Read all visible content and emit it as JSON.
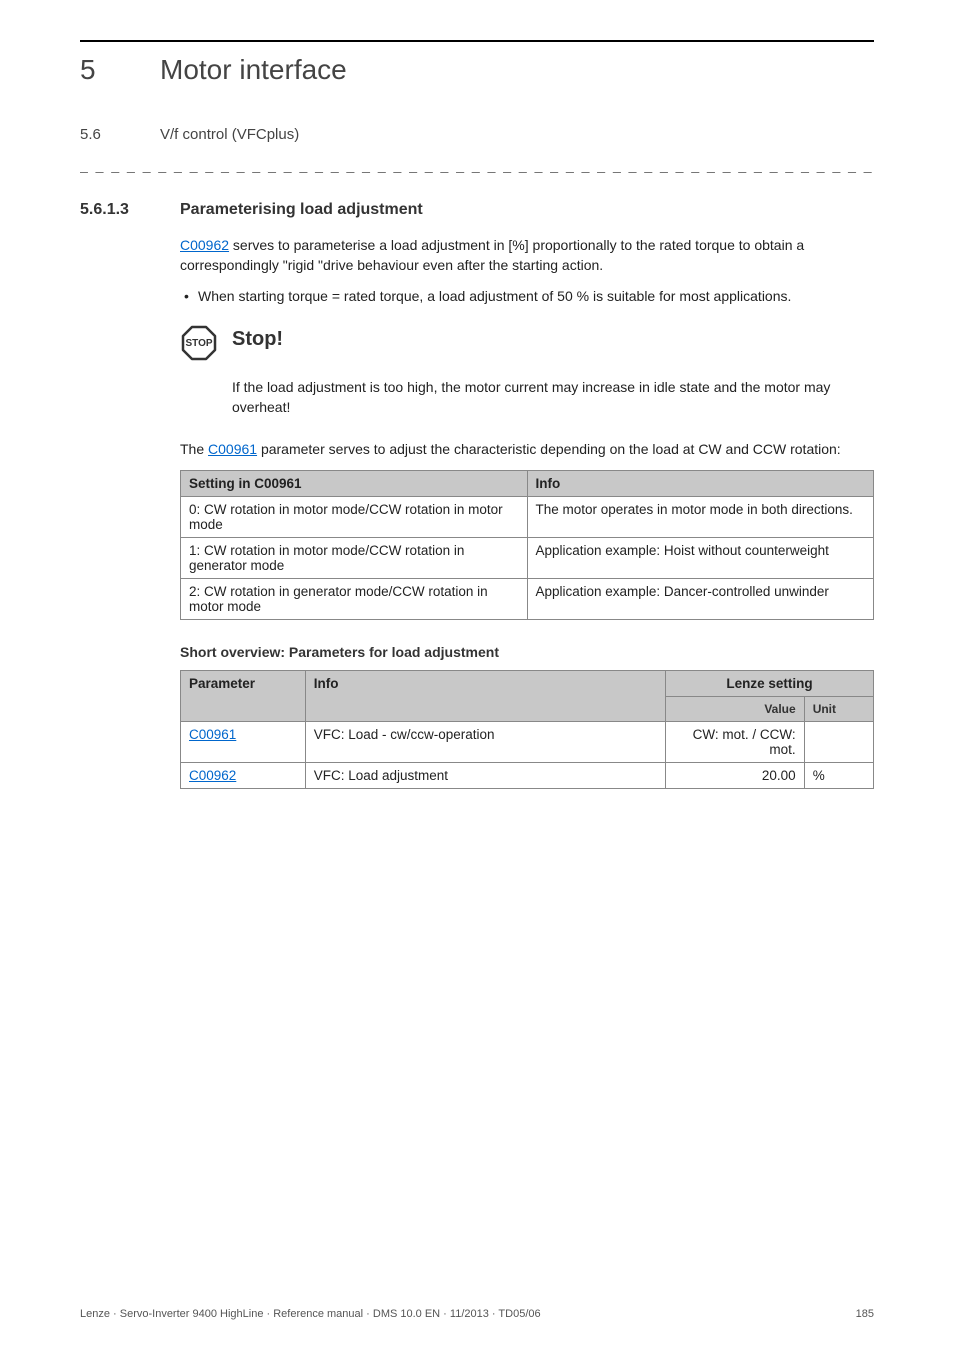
{
  "header": {
    "chapter_num": "5",
    "chapter_title": "Motor interface",
    "section_num": "5.6",
    "section_title": "V/f control (VFCplus)"
  },
  "dashed": "_ _ _ _ _ _ _ _ _ _ _ _ _ _ _ _ _ _ _ _ _ _ _ _ _ _ _ _ _ _ _ _ _ _ _ _ _ _ _ _ _ _ _ _ _ _ _ _ _ _ _ _ _ _ _ _ _ _ _ _ _ _ _ _",
  "heading": {
    "num": "5.6.1.3",
    "title": "Parameterising load adjustment"
  },
  "para1_link": "C00962",
  "para1_rest": " serves to parameterise a load adjustment in [%] proportionally to the rated torque to obtain a correspondingly \"rigid \"drive behaviour even after the starting action.",
  "bullet1": "When starting torque = rated torque, a load adjustment of 50 % is suitable for most applications.",
  "stop": {
    "title": "Stop!",
    "text": "If the load adjustment is too high, the motor current may increase in idle state and the motor may overheat!"
  },
  "para2_pre": "The ",
  "para2_link": "C00961",
  "para2_post": " parameter serves to adjust the characteristic depending on the load at CW and CCW rotation:",
  "table1": {
    "head": [
      "Setting in C00961",
      "Info"
    ],
    "rows": [
      [
        "0: CW rotation in motor mode/CCW rotation in motor mode",
        "The motor operates in motor mode in both directions."
      ],
      [
        "1: CW rotation in motor mode/CCW rotation in generator mode",
        "Application example: Hoist without counterweight"
      ],
      [
        "2: CW rotation in generator mode/CCW rotation in motor mode",
        "Application example: Dancer-controlled unwinder"
      ]
    ]
  },
  "shortov_title": "Short overview: Parameters for load adjustment",
  "table2": {
    "head": [
      "Parameter",
      "Info",
      "Lenze setting"
    ],
    "subhead": [
      "Value",
      "Unit"
    ],
    "rows": [
      {
        "param": "C00961",
        "info": "VFC: Load - cw/ccw-operation",
        "value": "CW: mot. / CCW: mot.",
        "unit": ""
      },
      {
        "param": "C00962",
        "info": "VFC: Load adjustment",
        "value": "20.00",
        "unit": "%"
      }
    ]
  },
  "footer": {
    "left": "Lenze · Servo-Inverter 9400 HighLine · Reference manual · DMS 10.0 EN · 11/2013 · TD05/06",
    "right": "185"
  }
}
